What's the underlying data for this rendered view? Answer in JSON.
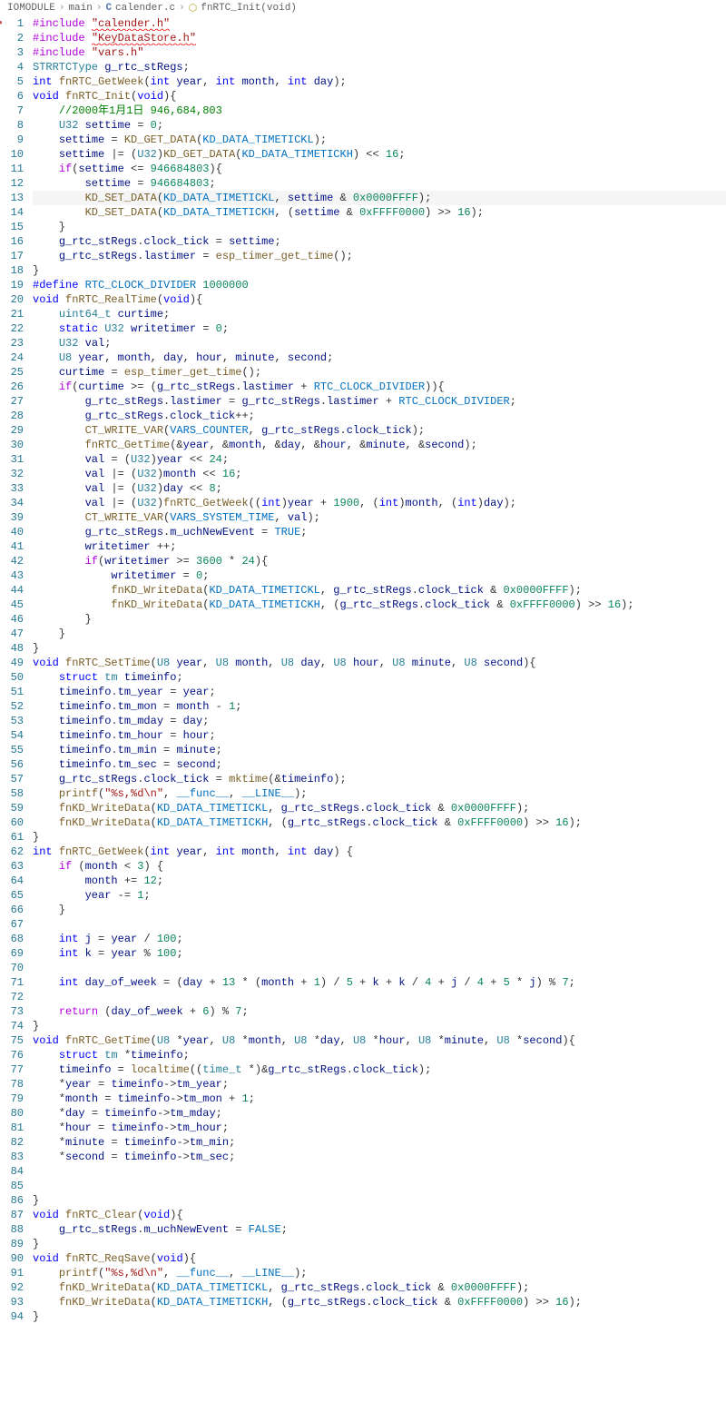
{
  "breadcrumb": {
    "parts": [
      "IOMODULE",
      "main",
      "calender.c",
      "fnRTC_Init(void)"
    ]
  },
  "lines": [
    {
      "n": 1,
      "dot": true,
      "html": "<span class='macro'>#include</span> <span class='squiggly'><span class='str'>\"calender.h\"</span></span>"
    },
    {
      "n": 2,
      "html": "<span class='macro'>#include</span> <span class='squiggly'><span class='str'>\"KeyDataStore.h\"</span></span>"
    },
    {
      "n": 3,
      "html": "<span class='macro'>#include</span> <span class='str'>\"vars.h\"</span>"
    },
    {
      "n": 4,
      "html": "<span class='type'>STRRTCType</span> <span class='var'>g_rtc_stRegs</span>;"
    },
    {
      "n": 5,
      "html": "<span class='kw'>int</span> <span class='fn'>fnRTC_GetWeek</span>(<span class='kw'>int</span> <span class='param'>year</span>, <span class='kw'>int</span> <span class='param'>month</span>, <span class='kw'>int</span> <span class='param'>day</span>);"
    },
    {
      "n": 6,
      "html": "<span class='kw'>void</span> <span class='fn'>fnRTC_Init</span>(<span class='kw'>void</span>){"
    },
    {
      "n": 7,
      "html": "    <span class='com'>//2000年1月1日 946,684,803</span>"
    },
    {
      "n": 8,
      "html": "    <span class='type'>U32</span> <span class='var'>settime</span> = <span class='num'>0</span>;"
    },
    {
      "n": 9,
      "html": "    <span class='var'>settime</span> = <span class='fn'>KD_GET_DATA</span>(<span class='const'>KD_DATA_TIMETICKL</span>);"
    },
    {
      "n": 10,
      "html": "    <span class='var'>settime</span> |= (<span class='type'>U32</span>)<span class='fn'>KD_GET_DATA</span>(<span class='const'>KD_DATA_TIMETICKH</span>) &lt;&lt; <span class='num'>16</span>;"
    },
    {
      "n": 11,
      "html": "    <span class='purple'>if</span>(<span class='var'>settime</span> &lt;= <span class='num'>946684803</span>){"
    },
    {
      "n": 12,
      "html": "        <span class='var'>settime</span> = <span class='num'>946684803</span>;"
    },
    {
      "n": 13,
      "hl": true,
      "html": "        <span class='fn'>KD_SET_DATA</span>(<span class='const'>KD_DATA_TIMETICKL</span>, <span class='var'>settime</span> &amp; <span class='num'>0x0000FFFF</span>);"
    },
    {
      "n": 14,
      "html": "        <span class='fn'>KD_SET_DATA</span>(<span class='const'>KD_DATA_TIMETICKH</span>, (<span class='var'>settime</span> &amp; <span class='num'>0xFFFF0000</span>) &gt;&gt; <span class='num'>16</span>);"
    },
    {
      "n": 15,
      "html": "    }"
    },
    {
      "n": 16,
      "html": "    <span class='var'>g_rtc_stRegs</span>.<span class='var'>clock_tick</span> = <span class='var'>settime</span>;"
    },
    {
      "n": 17,
      "html": "    <span class='var'>g_rtc_stRegs</span>.<span class='var'>lastimer</span> = <span class='fn'>esp_timer_get_time</span>();"
    },
    {
      "n": 18,
      "html": "}"
    },
    {
      "n": 19,
      "html": "<span class='macrodef'>#define</span> <span class='const'>RTC_CLOCK_DIVIDER</span> <span class='num'>1000000</span>"
    },
    {
      "n": 20,
      "html": "<span class='kw'>void</span> <span class='fn'>fnRTC_RealTime</span>(<span class='kw'>void</span>){"
    },
    {
      "n": 21,
      "html": "    <span class='type'>uint64_t</span> <span class='var'>curtime</span>;"
    },
    {
      "n": 22,
      "html": "    <span class='kw'>static</span> <span class='type'>U32</span> <span class='var'>writetimer</span> = <span class='num'>0</span>;"
    },
    {
      "n": 23,
      "html": "    <span class='type'>U32</span> <span class='var'>val</span>;"
    },
    {
      "n": 24,
      "html": "    <span class='type'>U8</span> <span class='var'>year</span>, <span class='var'>month</span>, <span class='var'>day</span>, <span class='var'>hour</span>, <span class='var'>minute</span>, <span class='var'>second</span>;"
    },
    {
      "n": 25,
      "html": "    <span class='var'>curtime</span> = <span class='fn'>esp_timer_get_time</span>();"
    },
    {
      "n": 26,
      "html": "    <span class='purple'>if</span>(<span class='var'>curtime</span> &gt;= (<span class='var'>g_rtc_stRegs</span>.<span class='var'>lastimer</span> + <span class='const'>RTC_CLOCK_DIVIDER</span>)){"
    },
    {
      "n": 27,
      "html": "        <span class='var'>g_rtc_stRegs</span>.<span class='var'>lastimer</span> = <span class='var'>g_rtc_stRegs</span>.<span class='var'>lastimer</span> + <span class='const'>RTC_CLOCK_DIVIDER</span>;"
    },
    {
      "n": 28,
      "html": "        <span class='var'>g_rtc_stRegs</span>.<span class='var'>clock_tick</span>++;"
    },
    {
      "n": 29,
      "html": "        <span class='fn'>CT_WRITE_VAR</span>(<span class='const'>VARS_COUNTER</span>, <span class='var'>g_rtc_stRegs</span>.<span class='var'>clock_tick</span>);"
    },
    {
      "n": 30,
      "html": "        <span class='fn'>fnRTC_GetTime</span>(&amp;<span class='var'>year</span>, &amp;<span class='var'>month</span>, &amp;<span class='var'>day</span>, &amp;<span class='var'>hour</span>, &amp;<span class='var'>minute</span>, &amp;<span class='var'>second</span>);"
    },
    {
      "n": 31,
      "html": "        <span class='var'>val</span> = (<span class='type'>U32</span>)<span class='var'>year</span> &lt;&lt; <span class='num'>24</span>;"
    },
    {
      "n": 32,
      "html": "        <span class='var'>val</span> |= (<span class='type'>U32</span>)<span class='var'>month</span> &lt;&lt; <span class='num'>16</span>;"
    },
    {
      "n": 33,
      "html": "        <span class='var'>val</span> |= (<span class='type'>U32</span>)<span class='var'>day</span> &lt;&lt; <span class='num'>8</span>;"
    },
    {
      "n": 34,
      "html": "        <span class='var'>val</span> |= (<span class='type'>U32</span>)<span class='fn'>fnRTC_GetWeek</span>((<span class='kw'>int</span>)<span class='var'>year</span> + <span class='num'>1900</span>, (<span class='kw'>int</span>)<span class='var'>month</span>, (<span class='kw'>int</span>)<span class='var'>day</span>);"
    },
    {
      "n": 39,
      "html": "        <span class='fn'>CT_WRITE_VAR</span>(<span class='const'>VARS_SYSTEM_TIME</span>, <span class='var'>val</span>);"
    },
    {
      "n": 40,
      "html": "        <span class='var'>g_rtc_stRegs</span>.<span class='var'>m_uchNewEvent</span> = <span class='const'>TRUE</span>;"
    },
    {
      "n": 41,
      "html": "        <span class='var'>writetimer</span> ++;"
    },
    {
      "n": 42,
      "html": "        <span class='purple'>if</span>(<span class='var'>writetimer</span> &gt;= <span class='num'>3600</span> * <span class='num'>24</span>){"
    },
    {
      "n": 43,
      "html": "            <span class='var'>writetimer</span> = <span class='num'>0</span>;"
    },
    {
      "n": 44,
      "html": "            <span class='fn'>fnKD_WriteData</span>(<span class='const'>KD_DATA_TIMETICKL</span>, <span class='var'>g_rtc_stRegs</span>.<span class='var'>clock_tick</span> &amp; <span class='num'>0x0000FFFF</span>);"
    },
    {
      "n": 45,
      "html": "            <span class='fn'>fnKD_WriteData</span>(<span class='const'>KD_DATA_TIMETICKH</span>, (<span class='var'>g_rtc_stRegs</span>.<span class='var'>clock_tick</span> &amp; <span class='num'>0xFFFF0000</span>) &gt;&gt; <span class='num'>16</span>);"
    },
    {
      "n": 46,
      "html": "        }"
    },
    {
      "n": 47,
      "html": "    }"
    },
    {
      "n": 48,
      "html": "}"
    },
    {
      "n": 49,
      "html": "<span class='kw'>void</span> <span class='fn'>fnRTC_SetTime</span>(<span class='type'>U8</span> <span class='param'>year</span>, <span class='type'>U8</span> <span class='param'>month</span>, <span class='type'>U8</span> <span class='param'>day</span>, <span class='type'>U8</span> <span class='param'>hour</span>, <span class='type'>U8</span> <span class='param'>minute</span>, <span class='type'>U8</span> <span class='param'>second</span>){"
    },
    {
      "n": 50,
      "html": "    <span class='kw'>struct</span> <span class='type'>tm</span> <span class='var'>timeinfo</span>;"
    },
    {
      "n": 51,
      "html": "    <span class='var'>timeinfo</span>.<span class='var'>tm_year</span> = <span class='var'>year</span>;"
    },
    {
      "n": 52,
      "html": "    <span class='var'>timeinfo</span>.<span class='var'>tm_mon</span> = <span class='var'>month</span> - <span class='num'>1</span>;"
    },
    {
      "n": 53,
      "html": "    <span class='var'>timeinfo</span>.<span class='var'>tm_mday</span> = <span class='var'>day</span>;"
    },
    {
      "n": 54,
      "html": "    <span class='var'>timeinfo</span>.<span class='var'>tm_hour</span> = <span class='var'>hour</span>;"
    },
    {
      "n": 55,
      "html": "    <span class='var'>timeinfo</span>.<span class='var'>tm_min</span> = <span class='var'>minute</span>;"
    },
    {
      "n": 56,
      "html": "    <span class='var'>timeinfo</span>.<span class='var'>tm_sec</span> = <span class='var'>second</span>;"
    },
    {
      "n": 57,
      "html": "    <span class='var'>g_rtc_stRegs</span>.<span class='var'>clock_tick</span> = <span class='fn'>mktime</span>(&amp;<span class='var'>timeinfo</span>);"
    },
    {
      "n": 58,
      "html": "    <span class='fn'>printf</span>(<span class='str'>\"%s,%d\\n\"</span>, <span class='const'>__func__</span>, <span class='const'>__LINE__</span>);"
    },
    {
      "n": 59,
      "html": "    <span class='fn'>fnKD_WriteData</span>(<span class='const'>KD_DATA_TIMETICKL</span>, <span class='var'>g_rtc_stRegs</span>.<span class='var'>clock_tick</span> &amp; <span class='num'>0x0000FFFF</span>);"
    },
    {
      "n": 60,
      "html": "    <span class='fn'>fnKD_WriteData</span>(<span class='const'>KD_DATA_TIMETICKH</span>, (<span class='var'>g_rtc_stRegs</span>.<span class='var'>clock_tick</span> &amp; <span class='num'>0xFFFF0000</span>) &gt;&gt; <span class='num'>16</span>);"
    },
    {
      "n": 61,
      "html": "}"
    },
    {
      "n": 62,
      "html": "<span class='kw'>int</span> <span class='fn'>fnRTC_GetWeek</span>(<span class='kw'>int</span> <span class='param'>year</span>, <span class='kw'>int</span> <span class='param'>month</span>, <span class='kw'>int</span> <span class='param'>day</span>) {"
    },
    {
      "n": 63,
      "html": "    <span class='purple'>if</span> (<span class='var'>month</span> &lt; <span class='num'>3</span>) {"
    },
    {
      "n": 64,
      "html": "        <span class='var'>month</span> += <span class='num'>12</span>;"
    },
    {
      "n": 65,
      "html": "        <span class='var'>year</span> -= <span class='num'>1</span>;"
    },
    {
      "n": 66,
      "html": "    }"
    },
    {
      "n": 67,
      "html": ""
    },
    {
      "n": 68,
      "html": "    <span class='kw'>int</span> <span class='var'>j</span> = <span class='var'>year</span> / <span class='num'>100</span>;"
    },
    {
      "n": 69,
      "html": "    <span class='kw'>int</span> <span class='var'>k</span> = <span class='var'>year</span> % <span class='num'>100</span>;"
    },
    {
      "n": 70,
      "html": ""
    },
    {
      "n": 71,
      "html": "    <span class='kw'>int</span> <span class='var'>day_of_week</span> = (<span class='var'>day</span> + <span class='num'>13</span> * (<span class='var'>month</span> + <span class='num'>1</span>) / <span class='num'>5</span> + <span class='var'>k</span> + <span class='var'>k</span> / <span class='num'>4</span> + <span class='var'>j</span> / <span class='num'>4</span> + <span class='num'>5</span> * <span class='var'>j</span>) % <span class='num'>7</span>;"
    },
    {
      "n": 72,
      "html": ""
    },
    {
      "n": 73,
      "html": "    <span class='purple'>return</span> (<span class='var'>day_of_week</span> + <span class='num'>6</span>) % <span class='num'>7</span>;"
    },
    {
      "n": 74,
      "html": "}"
    },
    {
      "n": 75,
      "html": "<span class='kw'>void</span> <span class='fn'>fnRTC_GetTime</span>(<span class='type'>U8</span> *<span class='param'>year</span>, <span class='type'>U8</span> *<span class='param'>month</span>, <span class='type'>U8</span> *<span class='param'>day</span>, <span class='type'>U8</span> *<span class='param'>hour</span>, <span class='type'>U8</span> *<span class='param'>minute</span>, <span class='type'>U8</span> *<span class='param'>second</span>){"
    },
    {
      "n": 76,
      "html": "    <span class='kw'>struct</span> <span class='type'>tm</span> *<span class='var'>timeinfo</span>;"
    },
    {
      "n": 77,
      "html": "    <span class='var'>timeinfo</span> = <span class='fn'>localtime</span>((<span class='type'>time_t</span> *)&amp;<span class='var'>g_rtc_stRegs</span>.<span class='var'>clock_tick</span>);"
    },
    {
      "n": 78,
      "html": "    *<span class='var'>year</span> = <span class='var'>timeinfo</span>-&gt;<span class='var'>tm_year</span>;"
    },
    {
      "n": 79,
      "html": "    *<span class='var'>month</span> = <span class='var'>timeinfo</span>-&gt;<span class='var'>tm_mon</span> + <span class='num'>1</span>;"
    },
    {
      "n": 80,
      "html": "    *<span class='var'>day</span> = <span class='var'>timeinfo</span>-&gt;<span class='var'>tm_mday</span>;"
    },
    {
      "n": 81,
      "html": "    *<span class='var'>hour</span> = <span class='var'>timeinfo</span>-&gt;<span class='var'>tm_hour</span>;"
    },
    {
      "n": 82,
      "html": "    *<span class='var'>minute</span> = <span class='var'>timeinfo</span>-&gt;<span class='var'>tm_min</span>;"
    },
    {
      "n": 83,
      "html": "    *<span class='var'>second</span> = <span class='var'>timeinfo</span>-&gt;<span class='var'>tm_sec</span>;"
    },
    {
      "n": 84,
      "html": ""
    },
    {
      "n": 85,
      "html": ""
    },
    {
      "n": 86,
      "html": "}"
    },
    {
      "n": 87,
      "html": "<span class='kw'>void</span> <span class='fn'>fnRTC_Clear</span>(<span class='kw'>void</span>){"
    },
    {
      "n": 88,
      "html": "    <span class='var'>g_rtc_stRegs</span>.<span class='var'>m_uchNewEvent</span> = <span class='const'>FALSE</span>;"
    },
    {
      "n": 89,
      "html": "}"
    },
    {
      "n": 90,
      "html": "<span class='kw'>void</span> <span class='fn'>fnRTC_ReqSave</span>(<span class='kw'>void</span>){"
    },
    {
      "n": 91,
      "html": "    <span class='fn'>printf</span>(<span class='str'>\"%s,%d\\n\"</span>, <span class='const'>__func__</span>, <span class='const'>__LINE__</span>);"
    },
    {
      "n": 92,
      "html": "    <span class='fn'>fnKD_WriteData</span>(<span class='const'>KD_DATA_TIMETICKL</span>, <span class='var'>g_rtc_stRegs</span>.<span class='var'>clock_tick</span> &amp; <span class='num'>0x0000FFFF</span>);"
    },
    {
      "n": 93,
      "html": "    <span class='fn'>fnKD_WriteData</span>(<span class='const'>KD_DATA_TIMETICKH</span>, (<span class='var'>g_rtc_stRegs</span>.<span class='var'>clock_tick</span> &amp; <span class='num'>0xFFFF0000</span>) &gt;&gt; <span class='num'>16</span>);"
    },
    {
      "n": 94,
      "html": "}"
    }
  ]
}
